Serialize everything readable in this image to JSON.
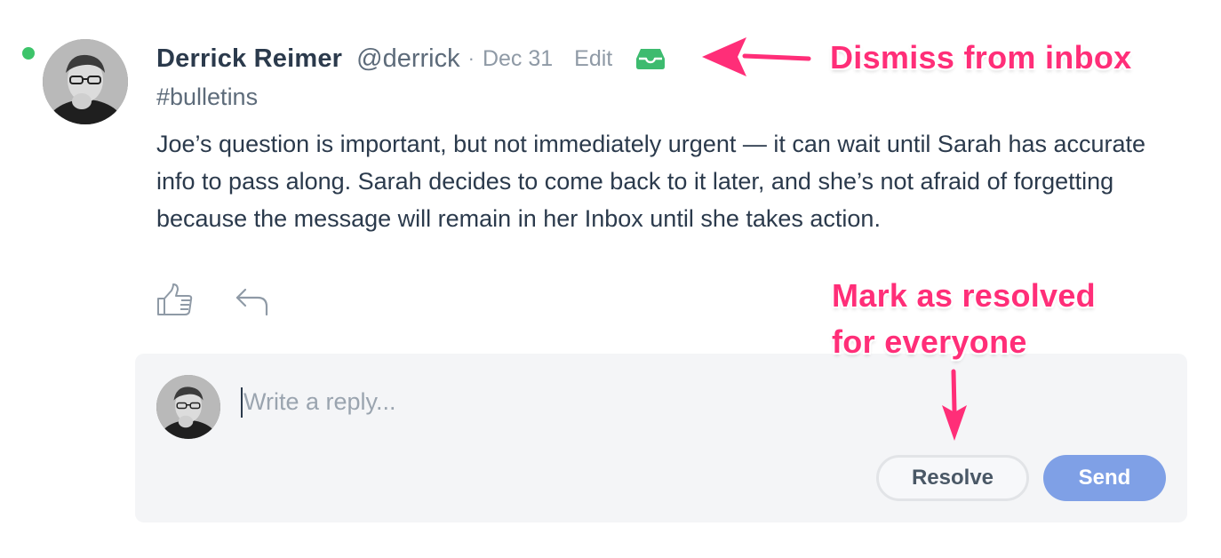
{
  "message": {
    "author_name": "Derrick Reimer",
    "author_handle": "@derrick",
    "separator": "·",
    "date": "Dec 31",
    "edit_label": "Edit",
    "channel": "#bulletins",
    "body": "Joe’s question is important, but not immediately urgent — it can wait until Sarah has accurate info to pass along. Sarah decides to come back to it later, and she’s not afraid of forgetting because the message will remain in her Inbox until she takes action.",
    "presence": "online",
    "icons": {
      "inbox": "inbox-tray-icon",
      "like": "thumbs-up-icon",
      "reply": "reply-arrow-icon"
    }
  },
  "composer": {
    "placeholder": "Write a reply...",
    "value": "",
    "resolve_label": "Resolve",
    "send_label": "Send"
  },
  "annotations": {
    "dismiss": "Dismiss from inbox",
    "resolve_line1": "Mark as resolved",
    "resolve_line2": "for everyone"
  },
  "colors": {
    "presence": "#3dc46a",
    "inbox_icon": "#3dbb6f",
    "send_button": "#7fa0e6",
    "annotation": "#ff2e78",
    "composer_bg": "#f4f5f7"
  }
}
